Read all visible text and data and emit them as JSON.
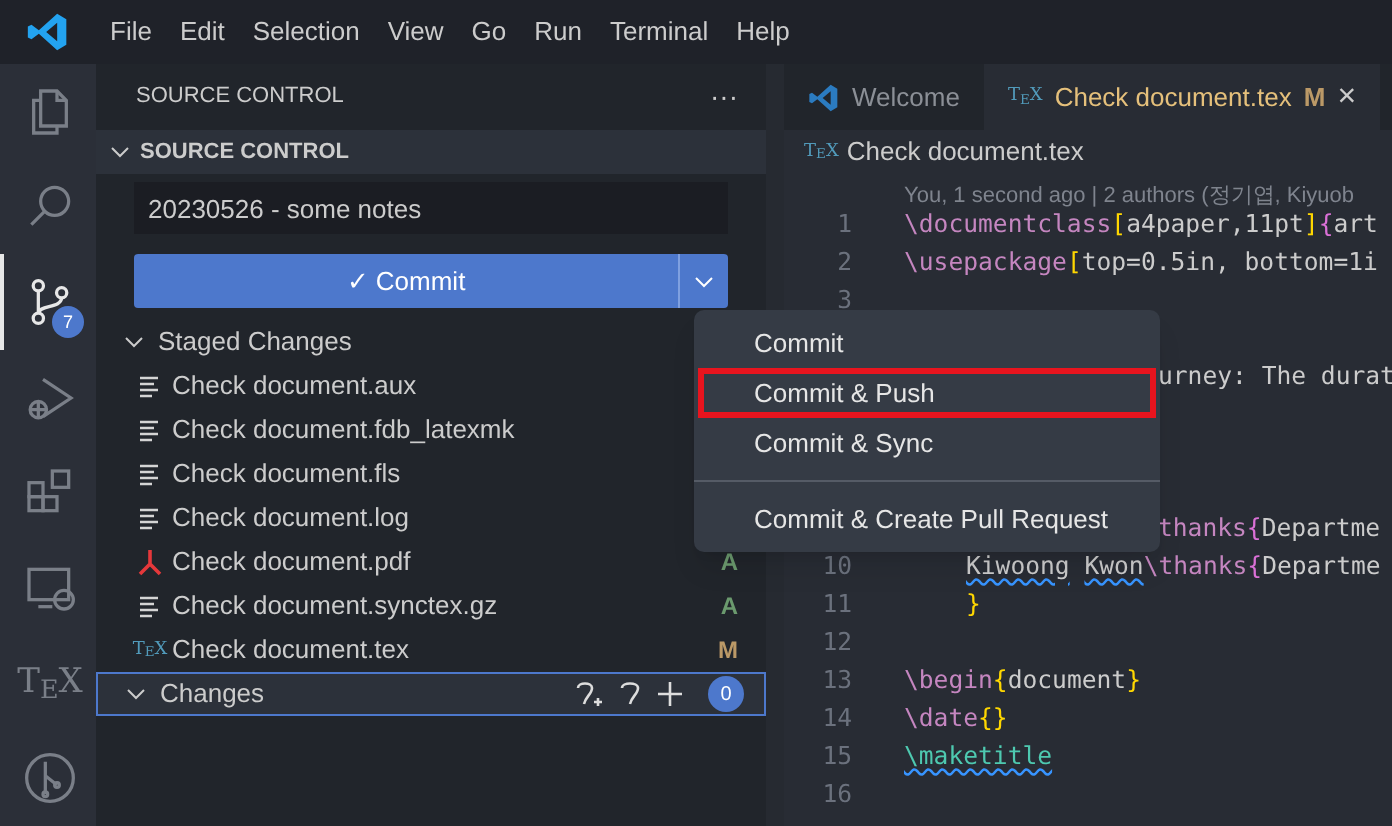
{
  "menu_bar": [
    "File",
    "Edit",
    "Selection",
    "View",
    "Go",
    "Run",
    "Terminal",
    "Help"
  ],
  "activity_bar": [
    {
      "kind": "files",
      "selected": false
    },
    {
      "kind": "search",
      "selected": false
    },
    {
      "kind": "branch",
      "selected": true,
      "badge": "7"
    },
    {
      "kind": "debug",
      "selected": false
    },
    {
      "kind": "extensions",
      "selected": false
    },
    {
      "kind": "monitor",
      "selected": false
    },
    {
      "kind": "glyph",
      "glyph": "T$_{E}$X",
      "selected": false
    },
    {
      "kind": "graph",
      "selected": false
    }
  ],
  "sidebar": {
    "title": "SOURCE CONTROL",
    "more": "···",
    "section": "SOURCE CONTROL",
    "message": "20230526 - some notes",
    "commit_button": "✓ Commit",
    "staged": {
      "label": "Staged Changes",
      "files": [
        {
          "name": "Check document.aux",
          "kind": "text"
        },
        {
          "name": "Check document.fdb_latexmk",
          "kind": "text"
        },
        {
          "name": "Check document.fls",
          "kind": "text"
        },
        {
          "name": "Check document.log",
          "kind": "text"
        },
        {
          "name": "Check document.pdf",
          "kind": "pdf",
          "status": "A"
        },
        {
          "name": "Check document.synctex.gz",
          "kind": "text",
          "status": "A"
        },
        {
          "name": "Check document.tex",
          "kind": "glyph",
          "glyph": "T$_{E}$X",
          "status": "M"
        }
      ]
    },
    "changes": {
      "label": "Changes",
      "count": "0"
    }
  },
  "tabs": [
    {
      "label": "Welcome",
      "kind": "logo",
      "selected": false
    },
    {
      "label": "Check document.tex",
      "kind": "glyph",
      "glyph": "T$_{E}$X",
      "status": "M",
      "close": "×",
      "selected": true
    }
  ],
  "breadcrumb": {
    "glyph": "T$_{E}$X",
    "label": "Check document.tex"
  },
  "blame": "You, 1 second ago | 2 authors (정기엽, Kiyuob",
  "code_lines": [
    {
      "number": "1",
      "kind": "full",
      "parts": [
        {
          "kind": "cmd",
          "text": "\\documentclass"
        },
        {
          "kind": "br",
          "text": "["
        },
        {
          "kind": "txt",
          "text": "a4paper,11pt"
        },
        {
          "kind": "br",
          "text": "]"
        },
        {
          "kind": "br2",
          "text": "{"
        },
        {
          "kind": "txt",
          "text": "art"
        }
      ]
    },
    {
      "number": "2",
      "kind": "full",
      "parts": [
        {
          "kind": "cmd",
          "text": "\\usepackage"
        },
        {
          "kind": "br",
          "text": "["
        },
        {
          "kind": "txt",
          "text": "top=0.5in, bottom=1i"
        }
      ]
    },
    {
      "number": "3",
      "kind": "full"
    },
    {
      "kind": "covered"
    },
    {
      "kind": "covered",
      "parts": [
        {
          "kind": "txt",
          "text": "urney: The durat"
        }
      ]
    },
    {
      "kind": "covered"
    },
    {
      "kind": "covered"
    },
    {
      "kind": "covered"
    },
    {
      "kind": "covered",
      "parts": [
        {
          "kind": "cmd",
          "text": "thanks"
        },
        {
          "kind": "br2",
          "text": "{"
        },
        {
          "kind": "txt",
          "text": "Departme"
        }
      ]
    },
    {
      "number": "10",
      "kind": "full",
      "indent": true,
      "parts": [
        {
          "kind": "squig",
          "text": "Kiwoong"
        },
        {
          "kind": "squig2",
          "text": "Kwon"
        },
        {
          "kind": "cmd",
          "text": "\\thanks"
        },
        {
          "kind": "br2",
          "text": "{"
        },
        {
          "kind": "txt",
          "text": "Departme"
        }
      ]
    },
    {
      "number": "11",
      "kind": "full",
      "indent": true,
      "parts": [
        {
          "kind": "br",
          "text": "}"
        }
      ]
    },
    {
      "number": "12",
      "kind": "full"
    },
    {
      "number": "13",
      "kind": "full",
      "parts": [
        {
          "kind": "cmd",
          "text": "\\begin"
        },
        {
          "kind": "br",
          "text": "{"
        },
        {
          "kind": "txt",
          "text": "document"
        },
        {
          "kind": "br",
          "text": "}"
        }
      ]
    },
    {
      "number": "14",
      "kind": "full",
      "parts": [
        {
          "kind": "cmd",
          "text": "\\date"
        },
        {
          "kind": "br",
          "text": "{}"
        }
      ]
    },
    {
      "number": "15",
      "kind": "full",
      "parts": [
        {
          "kind": "squigcmd",
          "text": "\\maketitle"
        }
      ]
    },
    {
      "number": "16",
      "kind": "full"
    }
  ],
  "commit_menu": [
    {
      "label": "Commit",
      "kind": "item",
      "highlighted": false
    },
    {
      "label": "Commit & Push",
      "kind": "item",
      "highlighted": true
    },
    {
      "label": "Commit & Sync",
      "kind": "item",
      "highlighted": false
    },
    {
      "kind": "separator"
    },
    {
      "label": "Commit & Create Pull Request",
      "kind": "item",
      "highlighted": false
    }
  ]
}
